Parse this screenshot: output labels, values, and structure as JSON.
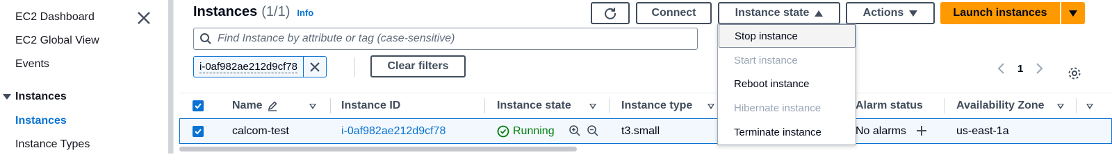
{
  "sidebar": {
    "links": [
      "EC2 Dashboard",
      "EC2 Global View",
      "Events"
    ],
    "section_label": "Instances",
    "section_items": [
      "Instances",
      "Instance Types"
    ]
  },
  "header": {
    "title": "Instances",
    "count": "(1/1)",
    "info": "Info"
  },
  "toolbar": {
    "connect_label": "Connect",
    "instance_state_label": "Instance state",
    "actions_label": "Actions",
    "launch_label": "Launch instances"
  },
  "search": {
    "placeholder": "Find Instance by attribute or tag (case-sensitive)"
  },
  "filter": {
    "token": "i-0af982ae212d9cf78",
    "clear_label": "Clear filters"
  },
  "pagination": {
    "current_page": "1"
  },
  "table": {
    "columns": {
      "name": "Name",
      "instance_id": "Instance ID",
      "instance_state": "Instance state",
      "instance_type": "Instance type",
      "alarm_status": "Alarm status",
      "availability_zone": "Availability Zone"
    },
    "rows": [
      {
        "name": "calcom-test",
        "instance_id": "i-0af982ae212d9cf78",
        "instance_state": "Running",
        "instance_type": "t3.small",
        "alarm_status": "No alarms",
        "availability_zone": "us-east-1a"
      }
    ]
  },
  "instance_state_menu": {
    "items": [
      {
        "label": "Stop instance",
        "disabled": false
      },
      {
        "label": "Start instance",
        "disabled": true
      },
      {
        "label": "Reboot instance",
        "disabled": false
      },
      {
        "label": "Hibernate instance",
        "disabled": true
      },
      {
        "label": "Terminate instance",
        "disabled": false
      }
    ]
  },
  "colors": {
    "link": "#0972d3",
    "primary": "#ff9900",
    "running": "#037f0c"
  }
}
